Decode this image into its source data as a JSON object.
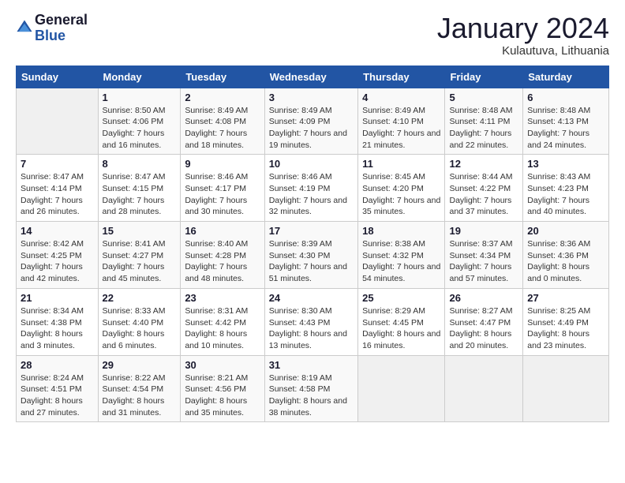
{
  "logo": {
    "general": "General",
    "blue": "Blue"
  },
  "header": {
    "title": "January 2024",
    "subtitle": "Kulautuva, Lithuania"
  },
  "weekdays": [
    "Sunday",
    "Monday",
    "Tuesday",
    "Wednesday",
    "Thursday",
    "Friday",
    "Saturday"
  ],
  "weeks": [
    [
      {
        "day": "",
        "sunrise": "",
        "sunset": "",
        "daylight": ""
      },
      {
        "day": "1",
        "sunrise": "Sunrise: 8:50 AM",
        "sunset": "Sunset: 4:06 PM",
        "daylight": "Daylight: 7 hours and 16 minutes."
      },
      {
        "day": "2",
        "sunrise": "Sunrise: 8:49 AM",
        "sunset": "Sunset: 4:08 PM",
        "daylight": "Daylight: 7 hours and 18 minutes."
      },
      {
        "day": "3",
        "sunrise": "Sunrise: 8:49 AM",
        "sunset": "Sunset: 4:09 PM",
        "daylight": "Daylight: 7 hours and 19 minutes."
      },
      {
        "day": "4",
        "sunrise": "Sunrise: 8:49 AM",
        "sunset": "Sunset: 4:10 PM",
        "daylight": "Daylight: 7 hours and 21 minutes."
      },
      {
        "day": "5",
        "sunrise": "Sunrise: 8:48 AM",
        "sunset": "Sunset: 4:11 PM",
        "daylight": "Daylight: 7 hours and 22 minutes."
      },
      {
        "day": "6",
        "sunrise": "Sunrise: 8:48 AM",
        "sunset": "Sunset: 4:13 PM",
        "daylight": "Daylight: 7 hours and 24 minutes."
      }
    ],
    [
      {
        "day": "7",
        "sunrise": "Sunrise: 8:47 AM",
        "sunset": "Sunset: 4:14 PM",
        "daylight": "Daylight: 7 hours and 26 minutes."
      },
      {
        "day": "8",
        "sunrise": "Sunrise: 8:47 AM",
        "sunset": "Sunset: 4:15 PM",
        "daylight": "Daylight: 7 hours and 28 minutes."
      },
      {
        "day": "9",
        "sunrise": "Sunrise: 8:46 AM",
        "sunset": "Sunset: 4:17 PM",
        "daylight": "Daylight: 7 hours and 30 minutes."
      },
      {
        "day": "10",
        "sunrise": "Sunrise: 8:46 AM",
        "sunset": "Sunset: 4:19 PM",
        "daylight": "Daylight: 7 hours and 32 minutes."
      },
      {
        "day": "11",
        "sunrise": "Sunrise: 8:45 AM",
        "sunset": "Sunset: 4:20 PM",
        "daylight": "Daylight: 7 hours and 35 minutes."
      },
      {
        "day": "12",
        "sunrise": "Sunrise: 8:44 AM",
        "sunset": "Sunset: 4:22 PM",
        "daylight": "Daylight: 7 hours and 37 minutes."
      },
      {
        "day": "13",
        "sunrise": "Sunrise: 8:43 AM",
        "sunset": "Sunset: 4:23 PM",
        "daylight": "Daylight: 7 hours and 40 minutes."
      }
    ],
    [
      {
        "day": "14",
        "sunrise": "Sunrise: 8:42 AM",
        "sunset": "Sunset: 4:25 PM",
        "daylight": "Daylight: 7 hours and 42 minutes."
      },
      {
        "day": "15",
        "sunrise": "Sunrise: 8:41 AM",
        "sunset": "Sunset: 4:27 PM",
        "daylight": "Daylight: 7 hours and 45 minutes."
      },
      {
        "day": "16",
        "sunrise": "Sunrise: 8:40 AM",
        "sunset": "Sunset: 4:28 PM",
        "daylight": "Daylight: 7 hours and 48 minutes."
      },
      {
        "day": "17",
        "sunrise": "Sunrise: 8:39 AM",
        "sunset": "Sunset: 4:30 PM",
        "daylight": "Daylight: 7 hours and 51 minutes."
      },
      {
        "day": "18",
        "sunrise": "Sunrise: 8:38 AM",
        "sunset": "Sunset: 4:32 PM",
        "daylight": "Daylight: 7 hours and 54 minutes."
      },
      {
        "day": "19",
        "sunrise": "Sunrise: 8:37 AM",
        "sunset": "Sunset: 4:34 PM",
        "daylight": "Daylight: 7 hours and 57 minutes."
      },
      {
        "day": "20",
        "sunrise": "Sunrise: 8:36 AM",
        "sunset": "Sunset: 4:36 PM",
        "daylight": "Daylight: 8 hours and 0 minutes."
      }
    ],
    [
      {
        "day": "21",
        "sunrise": "Sunrise: 8:34 AM",
        "sunset": "Sunset: 4:38 PM",
        "daylight": "Daylight: 8 hours and 3 minutes."
      },
      {
        "day": "22",
        "sunrise": "Sunrise: 8:33 AM",
        "sunset": "Sunset: 4:40 PM",
        "daylight": "Daylight: 8 hours and 6 minutes."
      },
      {
        "day": "23",
        "sunrise": "Sunrise: 8:31 AM",
        "sunset": "Sunset: 4:42 PM",
        "daylight": "Daylight: 8 hours and 10 minutes."
      },
      {
        "day": "24",
        "sunrise": "Sunrise: 8:30 AM",
        "sunset": "Sunset: 4:43 PM",
        "daylight": "Daylight: 8 hours and 13 minutes."
      },
      {
        "day": "25",
        "sunrise": "Sunrise: 8:29 AM",
        "sunset": "Sunset: 4:45 PM",
        "daylight": "Daylight: 8 hours and 16 minutes."
      },
      {
        "day": "26",
        "sunrise": "Sunrise: 8:27 AM",
        "sunset": "Sunset: 4:47 PM",
        "daylight": "Daylight: 8 hours and 20 minutes."
      },
      {
        "day": "27",
        "sunrise": "Sunrise: 8:25 AM",
        "sunset": "Sunset: 4:49 PM",
        "daylight": "Daylight: 8 hours and 23 minutes."
      }
    ],
    [
      {
        "day": "28",
        "sunrise": "Sunrise: 8:24 AM",
        "sunset": "Sunset: 4:51 PM",
        "daylight": "Daylight: 8 hours and 27 minutes."
      },
      {
        "day": "29",
        "sunrise": "Sunrise: 8:22 AM",
        "sunset": "Sunset: 4:54 PM",
        "daylight": "Daylight: 8 hours and 31 minutes."
      },
      {
        "day": "30",
        "sunrise": "Sunrise: 8:21 AM",
        "sunset": "Sunset: 4:56 PM",
        "daylight": "Daylight: 8 hours and 35 minutes."
      },
      {
        "day": "31",
        "sunrise": "Sunrise: 8:19 AM",
        "sunset": "Sunset: 4:58 PM",
        "daylight": "Daylight: 8 hours and 38 minutes."
      },
      {
        "day": "",
        "sunrise": "",
        "sunset": "",
        "daylight": ""
      },
      {
        "day": "",
        "sunrise": "",
        "sunset": "",
        "daylight": ""
      },
      {
        "day": "",
        "sunrise": "",
        "sunset": "",
        "daylight": ""
      }
    ]
  ]
}
